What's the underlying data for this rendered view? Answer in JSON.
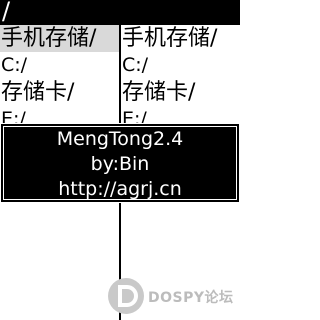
{
  "topbar": {
    "path": "/"
  },
  "left_pane": {
    "items": [
      {
        "label": "手机存储/",
        "sub": "C:/"
      },
      {
        "label": "存储卡/",
        "sub": "E:/"
      }
    ]
  },
  "right_pane": {
    "items": [
      {
        "label": "手机存储/",
        "sub": "C:/"
      },
      {
        "label": "存储卡/",
        "sub": "E:/"
      }
    ]
  },
  "dialog": {
    "line1": "MengTong2.4",
    "line2": "by:Bin",
    "line3": "http://agrj.cn"
  },
  "watermark": {
    "text": "DOSPY论坛"
  },
  "colors": {
    "topbar": "#000000",
    "selected_row": "#d9d9d9",
    "dialog_bg": "#000000",
    "dialog_text": "#ffffff"
  }
}
